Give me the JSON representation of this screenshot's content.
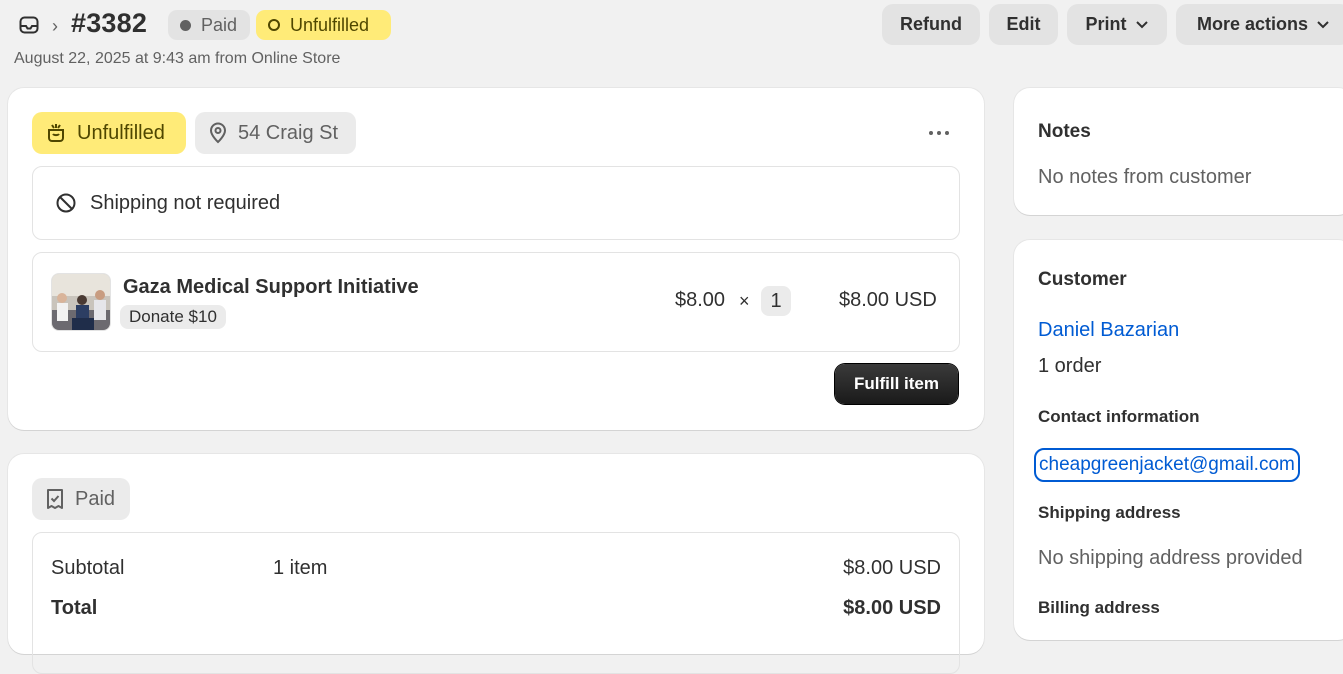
{
  "header": {
    "order_number": "#3382",
    "payment_badge": "Paid",
    "fulfillment_badge": "Unfulfilled",
    "date_line": "August 22, 2025 at 9:43 am from Online Store",
    "buttons": {
      "refund": "Refund",
      "edit": "Edit",
      "print": "Print",
      "more_actions": "More actions"
    }
  },
  "fulfillment_card": {
    "status": "Unfulfilled",
    "location": "54 Craig St",
    "shipping_note": "Shipping not required",
    "item": {
      "title": "Gaza Medical Support Initiative",
      "variant": "Donate $10",
      "price": "$8.00",
      "times": "×",
      "quantity": "1",
      "total": "$8.00 USD"
    },
    "fulfill_button": "Fulfill item"
  },
  "payment_card": {
    "status": "Paid",
    "rows": [
      {
        "label": "Subtotal",
        "mid": "1 item",
        "value": "$8.00 USD"
      },
      {
        "label": "Total",
        "mid": "",
        "value": "$8.00 USD"
      }
    ]
  },
  "notes_card": {
    "title": "Notes",
    "text": "No notes from customer"
  },
  "customer_card": {
    "title": "Customer",
    "name": "Daniel Bazarian",
    "orders": "1 order",
    "contact_title": "Contact information",
    "email": "cheapgreenjacket@gmail.com",
    "shipping_title": "Shipping address",
    "shipping_text": "No shipping address provided",
    "billing_title": "Billing address"
  },
  "colors": {
    "accent_link": "#005bd3",
    "unfulfilled_bg": "#ffeb78",
    "primary_button": "#1a1a1a"
  }
}
